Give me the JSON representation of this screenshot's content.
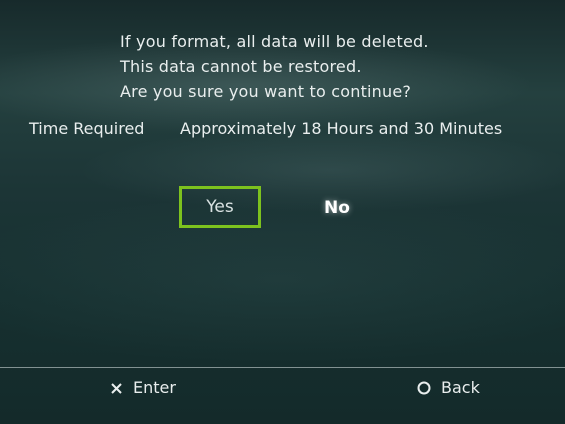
{
  "dialog": {
    "message_lines": [
      "If you format, all data will be deleted.",
      "This data cannot be restored.",
      "Are you sure you want to continue?"
    ],
    "time_label": "Time Required",
    "time_value": "Approximately 18 Hours and 30 Minutes",
    "buttons": {
      "yes": "Yes",
      "no": "No"
    },
    "selected": "yes"
  },
  "footer": {
    "enter_label": "Enter",
    "enter_icon": "cross-icon",
    "back_label": "Back",
    "back_icon": "circle-icon"
  },
  "colors": {
    "focus_border": "#7dc21e"
  }
}
